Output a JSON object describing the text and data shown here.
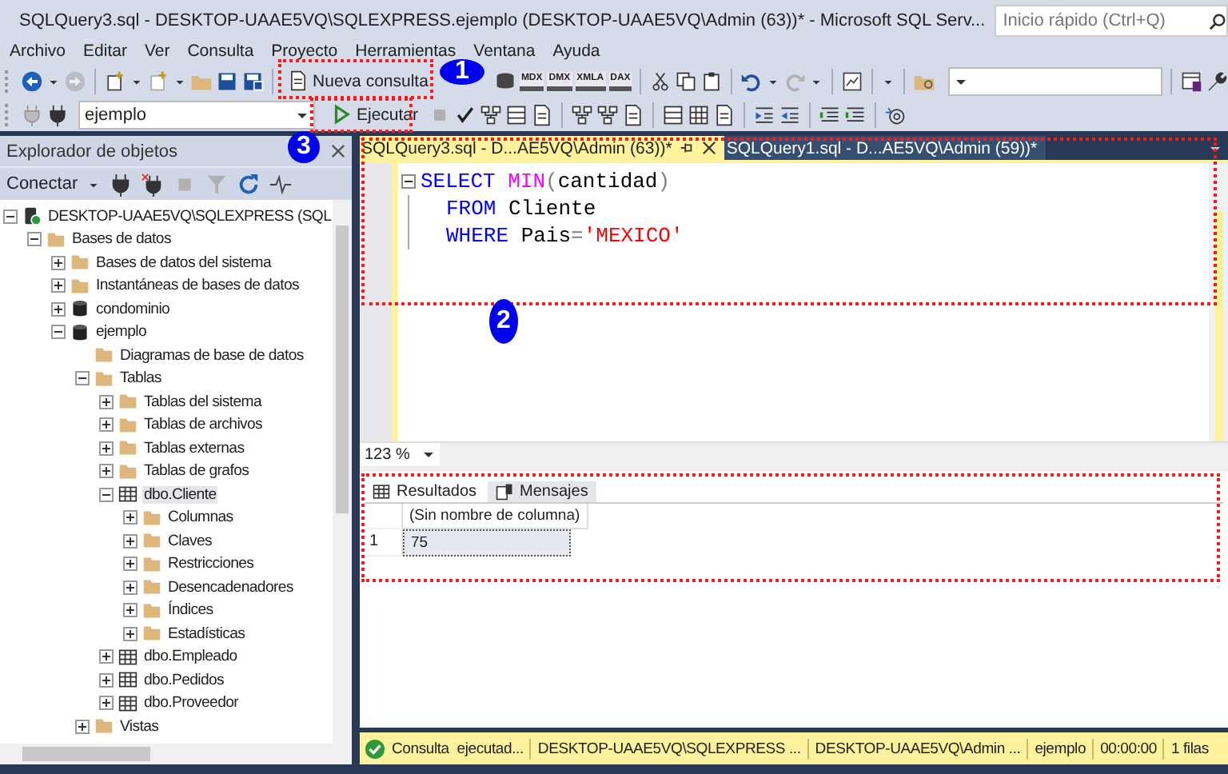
{
  "window": {
    "title": "SQLQuery3.sql - DESKTOP-UAAE5VQ\\SQLEXPRESS.ejemplo (DESKTOP-UAAE5VQ\\Admin (63))* - Microsoft SQL Serv...",
    "quick_launch": {
      "placeholder": "Inicio rápido (Ctrl+Q)"
    }
  },
  "menu": [
    "Archivo",
    "Editar",
    "Ver",
    "Consulta",
    "Proyecto",
    "Herramientas",
    "Ventana",
    "Ayuda"
  ],
  "toolbar": {
    "new_query": "Nueva consulta",
    "query_types": [
      "MDX",
      "DMX",
      "XMLA",
      "DAX"
    ],
    "database": "ejemplo",
    "execute": "Ejecutar"
  },
  "object_explorer": {
    "title": "Explorador de objetos",
    "connect": "Conectar",
    "tree": [
      {
        "label": "DESKTOP-UAAE5VQ\\SQLEXPRESS (SQL",
        "kind": "server",
        "expanded": true,
        "selected": false,
        "children": [
          {
            "label": "Bases de datos",
            "kind": "folder",
            "expanded": true,
            "selected": false,
            "children": [
              {
                "label": "Bases de datos del sistema",
                "kind": "folder",
                "expanded": false,
                "selected": false
              },
              {
                "label": "Instantáneas de bases de datos",
                "kind": "folder",
                "expanded": false,
                "selected": false
              },
              {
                "label": "condominio",
                "kind": "database",
                "expanded": false,
                "selected": false
              },
              {
                "label": "ejemplo",
                "kind": "database",
                "expanded": true,
                "selected": false,
                "children": [
                  {
                    "label": "Diagramas de base de datos",
                    "kind": "folder",
                    "selected": false
                  },
                  {
                    "label": "Tablas",
                    "kind": "folder",
                    "expanded": true,
                    "selected": false,
                    "children": [
                      {
                        "label": "Tablas del sistema",
                        "kind": "folder",
                        "expanded": false,
                        "selected": false
                      },
                      {
                        "label": "Tablas de archivos",
                        "kind": "folder",
                        "expanded": false,
                        "selected": false
                      },
                      {
                        "label": "Tablas externas",
                        "kind": "folder",
                        "expanded": false,
                        "selected": false
                      },
                      {
                        "label": "Tablas de grafos",
                        "kind": "folder",
                        "expanded": false,
                        "selected": false
                      },
                      {
                        "label": "dbo.Cliente",
                        "kind": "table",
                        "expanded": true,
                        "selected": true,
                        "children": [
                          {
                            "label": "Columnas",
                            "kind": "folder",
                            "expanded": false,
                            "selected": false
                          },
                          {
                            "label": "Claves",
                            "kind": "folder",
                            "expanded": false,
                            "selected": false
                          },
                          {
                            "label": "Restricciones",
                            "kind": "folder",
                            "expanded": false,
                            "selected": false
                          },
                          {
                            "label": "Desencadenadores",
                            "kind": "folder",
                            "expanded": false,
                            "selected": false
                          },
                          {
                            "label": "Índices",
                            "kind": "folder",
                            "expanded": false,
                            "selected": false
                          },
                          {
                            "label": "Estadísticas",
                            "kind": "folder",
                            "expanded": false,
                            "selected": false
                          }
                        ]
                      },
                      {
                        "label": "dbo.Empleado",
                        "kind": "table",
                        "expanded": false,
                        "selected": false
                      },
                      {
                        "label": "dbo.Pedidos",
                        "kind": "table",
                        "expanded": false,
                        "selected": false
                      },
                      {
                        "label": "dbo.Proveedor",
                        "kind": "table",
                        "expanded": false,
                        "selected": false
                      }
                    ]
                  },
                  {
                    "label": "Vistas",
                    "kind": "folder",
                    "expanded": false,
                    "selected": false
                  }
                ]
              }
            ]
          }
        ]
      }
    ]
  },
  "editor": {
    "tabs": [
      {
        "label": "SQLQuery3.sql - D...AE5VQ\\Admin (63))*",
        "selected": true
      },
      {
        "label": "SQLQuery1.sql - D...AE5VQ\\Admin (59))*",
        "selected": false
      }
    ],
    "lines": [
      [
        {
          "kind": "keyword",
          "text": "SELECT "
        },
        {
          "kind": "function",
          "text": "MIN"
        },
        {
          "kind": "operator",
          "text": "("
        },
        {
          "kind": "plain",
          "text": "cantidad"
        },
        {
          "kind": "operator",
          "text": ")"
        }
      ],
      [
        {
          "kind": "keyword",
          "text": "FROM"
        },
        {
          "kind": "plain",
          "text": " Cliente"
        }
      ],
      [
        {
          "kind": "keyword",
          "text": "WHERE"
        },
        {
          "kind": "plain",
          "text": " Pais"
        },
        {
          "kind": "operator",
          "text": "="
        },
        {
          "kind": "string",
          "text": "'MEXICO'"
        }
      ]
    ],
    "zoom": "123 %"
  },
  "results": {
    "tabs": [
      {
        "label": "Resultados",
        "selected": true
      },
      {
        "label": "Mensajes",
        "selected": false
      }
    ],
    "columns": [
      "(Sin nombre de columna)"
    ],
    "rows": [
      {
        "number": "1",
        "cells": [
          "75"
        ]
      }
    ]
  },
  "status_bar": {
    "message": "Consulta  ejecutad...",
    "server": "DESKTOP-UAAE5VQ\\SQLEXPRESS ...",
    "user": "DESKTOP-UAAE5VQ\\Admin ...",
    "database": "ejemplo",
    "time": "00:00:00",
    "rows": "1 filas"
  },
  "markers": [
    {
      "number": "1"
    },
    {
      "number": "2"
    },
    {
      "number": "3"
    }
  ]
}
